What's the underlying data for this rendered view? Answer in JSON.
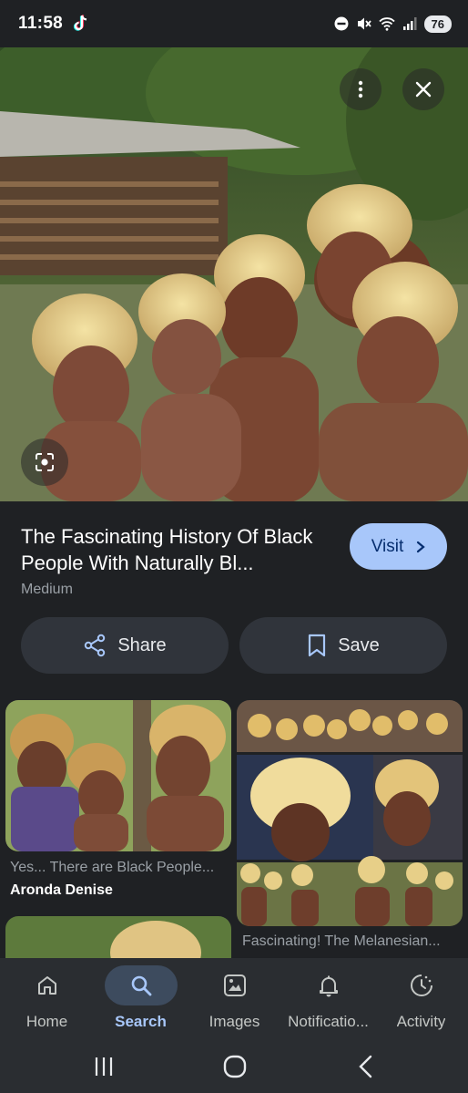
{
  "status_bar": {
    "time": "11:58",
    "battery": "76",
    "icons": [
      "tiktok-icon",
      "dnd-icon",
      "mute-icon",
      "wifi-icon",
      "signal-icon"
    ]
  },
  "hero": {
    "more_icon": "more-vert-icon",
    "close_icon": "close-icon",
    "lens_icon": "lens-icon"
  },
  "result": {
    "title": "The Fascinating History Of Black People With Naturally Bl...",
    "source": "Medium",
    "visit_label": "Visit",
    "share_label": "Share",
    "save_label": "Save"
  },
  "related": [
    {
      "caption": "Yes... There are Black People...",
      "source": "Aronda Denise"
    },
    {
      "caption": "Fascinating! The Melanesian..."
    }
  ],
  "bottom_nav": [
    {
      "label": "Home",
      "icon": "home-icon",
      "active": false
    },
    {
      "label": "Search",
      "icon": "search-icon",
      "active": true
    },
    {
      "label": "Images",
      "icon": "images-icon",
      "active": false
    },
    {
      "label": "Notificatio...",
      "icon": "bell-icon",
      "active": false
    },
    {
      "label": "Activity",
      "icon": "activity-icon",
      "active": false
    }
  ],
  "colors": {
    "background": "#1f2124",
    "accent": "#a8c7fa",
    "button_bg": "#30343b",
    "nav_bg": "#2a2d31"
  }
}
